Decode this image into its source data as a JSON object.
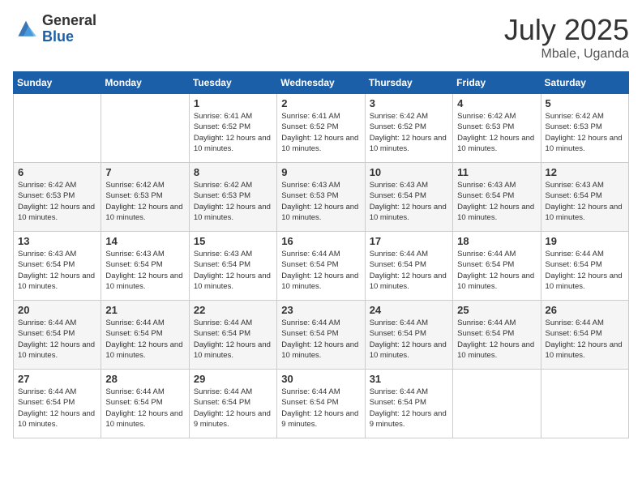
{
  "logo": {
    "general": "General",
    "blue": "Blue"
  },
  "title": {
    "month_year": "July 2025",
    "location": "Mbale, Uganda"
  },
  "days_of_week": [
    "Sunday",
    "Monday",
    "Tuesday",
    "Wednesday",
    "Thursday",
    "Friday",
    "Saturday"
  ],
  "weeks": [
    [
      {
        "day": "",
        "info": ""
      },
      {
        "day": "",
        "info": ""
      },
      {
        "day": "1",
        "info": "Sunrise: 6:41 AM\nSunset: 6:52 PM\nDaylight: 12 hours and 10 minutes."
      },
      {
        "day": "2",
        "info": "Sunrise: 6:41 AM\nSunset: 6:52 PM\nDaylight: 12 hours and 10 minutes."
      },
      {
        "day": "3",
        "info": "Sunrise: 6:42 AM\nSunset: 6:52 PM\nDaylight: 12 hours and 10 minutes."
      },
      {
        "day": "4",
        "info": "Sunrise: 6:42 AM\nSunset: 6:53 PM\nDaylight: 12 hours and 10 minutes."
      },
      {
        "day": "5",
        "info": "Sunrise: 6:42 AM\nSunset: 6:53 PM\nDaylight: 12 hours and 10 minutes."
      }
    ],
    [
      {
        "day": "6",
        "info": "Sunrise: 6:42 AM\nSunset: 6:53 PM\nDaylight: 12 hours and 10 minutes."
      },
      {
        "day": "7",
        "info": "Sunrise: 6:42 AM\nSunset: 6:53 PM\nDaylight: 12 hours and 10 minutes."
      },
      {
        "day": "8",
        "info": "Sunrise: 6:42 AM\nSunset: 6:53 PM\nDaylight: 12 hours and 10 minutes."
      },
      {
        "day": "9",
        "info": "Sunrise: 6:43 AM\nSunset: 6:53 PM\nDaylight: 12 hours and 10 minutes."
      },
      {
        "day": "10",
        "info": "Sunrise: 6:43 AM\nSunset: 6:54 PM\nDaylight: 12 hours and 10 minutes."
      },
      {
        "day": "11",
        "info": "Sunrise: 6:43 AM\nSunset: 6:54 PM\nDaylight: 12 hours and 10 minutes."
      },
      {
        "day": "12",
        "info": "Sunrise: 6:43 AM\nSunset: 6:54 PM\nDaylight: 12 hours and 10 minutes."
      }
    ],
    [
      {
        "day": "13",
        "info": "Sunrise: 6:43 AM\nSunset: 6:54 PM\nDaylight: 12 hours and 10 minutes."
      },
      {
        "day": "14",
        "info": "Sunrise: 6:43 AM\nSunset: 6:54 PM\nDaylight: 12 hours and 10 minutes."
      },
      {
        "day": "15",
        "info": "Sunrise: 6:43 AM\nSunset: 6:54 PM\nDaylight: 12 hours and 10 minutes."
      },
      {
        "day": "16",
        "info": "Sunrise: 6:44 AM\nSunset: 6:54 PM\nDaylight: 12 hours and 10 minutes."
      },
      {
        "day": "17",
        "info": "Sunrise: 6:44 AM\nSunset: 6:54 PM\nDaylight: 12 hours and 10 minutes."
      },
      {
        "day": "18",
        "info": "Sunrise: 6:44 AM\nSunset: 6:54 PM\nDaylight: 12 hours and 10 minutes."
      },
      {
        "day": "19",
        "info": "Sunrise: 6:44 AM\nSunset: 6:54 PM\nDaylight: 12 hours and 10 minutes."
      }
    ],
    [
      {
        "day": "20",
        "info": "Sunrise: 6:44 AM\nSunset: 6:54 PM\nDaylight: 12 hours and 10 minutes."
      },
      {
        "day": "21",
        "info": "Sunrise: 6:44 AM\nSunset: 6:54 PM\nDaylight: 12 hours and 10 minutes."
      },
      {
        "day": "22",
        "info": "Sunrise: 6:44 AM\nSunset: 6:54 PM\nDaylight: 12 hours and 10 minutes."
      },
      {
        "day": "23",
        "info": "Sunrise: 6:44 AM\nSunset: 6:54 PM\nDaylight: 12 hours and 10 minutes."
      },
      {
        "day": "24",
        "info": "Sunrise: 6:44 AM\nSunset: 6:54 PM\nDaylight: 12 hours and 10 minutes."
      },
      {
        "day": "25",
        "info": "Sunrise: 6:44 AM\nSunset: 6:54 PM\nDaylight: 12 hours and 10 minutes."
      },
      {
        "day": "26",
        "info": "Sunrise: 6:44 AM\nSunset: 6:54 PM\nDaylight: 12 hours and 10 minutes."
      }
    ],
    [
      {
        "day": "27",
        "info": "Sunrise: 6:44 AM\nSunset: 6:54 PM\nDaylight: 12 hours and 10 minutes."
      },
      {
        "day": "28",
        "info": "Sunrise: 6:44 AM\nSunset: 6:54 PM\nDaylight: 12 hours and 10 minutes."
      },
      {
        "day": "29",
        "info": "Sunrise: 6:44 AM\nSunset: 6:54 PM\nDaylight: 12 hours and 9 minutes."
      },
      {
        "day": "30",
        "info": "Sunrise: 6:44 AM\nSunset: 6:54 PM\nDaylight: 12 hours and 9 minutes."
      },
      {
        "day": "31",
        "info": "Sunrise: 6:44 AM\nSunset: 6:54 PM\nDaylight: 12 hours and 9 minutes."
      },
      {
        "day": "",
        "info": ""
      },
      {
        "day": "",
        "info": ""
      }
    ]
  ]
}
